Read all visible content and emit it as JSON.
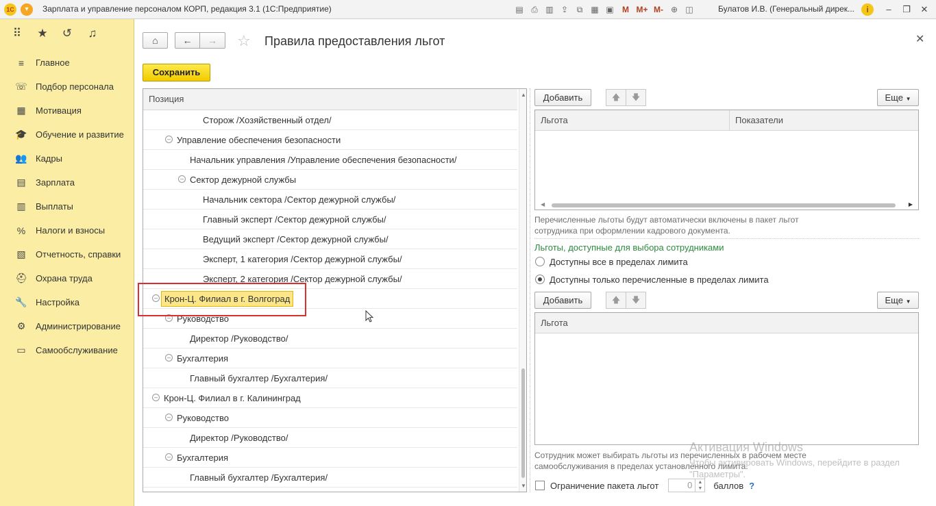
{
  "window": {
    "title": "Зарплата и управление персоналом КОРП, редакция 3.1  (1С:Предприятие)",
    "user": "Булатов И.В. (Генеральный дирек...",
    "toolbar_icons": [
      "save-icon",
      "print-icon",
      "preview-icon",
      "upload-icon",
      "copy-icon",
      "calculator-icon",
      "calendar-icon"
    ],
    "memory_buttons": [
      "M",
      "M+",
      "M-"
    ]
  },
  "sidebar": {
    "items": [
      {
        "label": "Главное",
        "icon": "≡"
      },
      {
        "label": "Подбор персонала",
        "icon": "☏"
      },
      {
        "label": "Мотивация",
        "icon": "▦"
      },
      {
        "label": "Обучение и развитие",
        "icon": "🎓"
      },
      {
        "label": "Кадры",
        "icon": "👥"
      },
      {
        "label": "Зарплата",
        "icon": "▤"
      },
      {
        "label": "Выплаты",
        "icon": "▥"
      },
      {
        "label": "Налоги и взносы",
        "icon": "%"
      },
      {
        "label": "Отчетность, справки",
        "icon": "▧"
      },
      {
        "label": "Охрана труда",
        "icon": "⛑"
      },
      {
        "label": "Настройка",
        "icon": "🔧"
      },
      {
        "label": "Администрирование",
        "icon": "⚙"
      },
      {
        "label": "Самообслуживание",
        "icon": "▭"
      }
    ]
  },
  "page": {
    "title": "Правила предоставления льгот",
    "save_label": "Сохранить"
  },
  "tree": {
    "header": "Позиция",
    "rows": [
      {
        "text": "Сторож /Хозяйственный отдел/",
        "level": 4,
        "toggle": false
      },
      {
        "text": "Управление обеспечения безопасности",
        "level": 2,
        "toggle": true
      },
      {
        "text": "Начальник управления /Управление обеспечения безопасности/",
        "level": 3,
        "toggle": false
      },
      {
        "text": "Сектор дежурной службы",
        "level": 3,
        "toggle": true
      },
      {
        "text": "Начальник сектора /Сектор дежурной службы/",
        "level": 4,
        "toggle": false
      },
      {
        "text": "Главный эксперт /Сектор дежурной службы/",
        "level": 4,
        "toggle": false
      },
      {
        "text": "Ведущий эксперт /Сектор дежурной службы/",
        "level": 4,
        "toggle": false
      },
      {
        "text": "Эксперт, 1 категория /Сектор дежурной службы/",
        "level": 4,
        "toggle": false
      },
      {
        "text": "Эксперт, 2 категория /Сектор дежурной службы/",
        "level": 4,
        "toggle": false
      },
      {
        "text": "Крон-Ц. Филиал в г. Волгоград",
        "level": 1,
        "toggle": true,
        "selected": true
      },
      {
        "text": "Руководство",
        "level": 2,
        "toggle": true
      },
      {
        "text": "Директор /Руководство/",
        "level": 3,
        "toggle": false
      },
      {
        "text": "Бухгалтерия",
        "level": 2,
        "toggle": true
      },
      {
        "text": "Главный бухгалтер /Бухгалтерия/",
        "level": 3,
        "toggle": false
      },
      {
        "text": "Крон-Ц. Филиал в г. Калининград",
        "level": 1,
        "toggle": true
      },
      {
        "text": "Руководство",
        "level": 2,
        "toggle": true
      },
      {
        "text": "Директор /Руководство/",
        "level": 3,
        "toggle": false
      },
      {
        "text": "Бухгалтерия",
        "level": 2,
        "toggle": true
      },
      {
        "text": "Главный бухгалтер /Бухгалтерия/",
        "level": 3,
        "toggle": false
      }
    ]
  },
  "benefits_top": {
    "add_label": "Добавить",
    "more_label": "Еще",
    "col_benefit": "Льгота",
    "col_indicators": "Показатели",
    "note": "Перечисленные льготы будут автоматически включены в пакет льгот сотрудника при оформлении кадрового документа."
  },
  "choice": {
    "title": "Льготы, доступные для выбора сотрудниками",
    "option_all": "Доступны все в пределах лимита",
    "option_listed": "Доступны только перечисленные в пределах лимита",
    "selected": "option_listed"
  },
  "benefits_bottom": {
    "add_label": "Добавить",
    "more_label": "Еще",
    "col_benefit": "Льгота",
    "note": "Сотрудник может выбирать льготы из перечисленных в рабочем месте самообслуживания в пределах установленного лимита."
  },
  "limit": {
    "checkbox_label": "Ограничение пакета льгот",
    "value": "0",
    "unit": "баллов",
    "help": "?"
  },
  "watermark": {
    "title": "Активация Windows",
    "text": "Чтобы активировать Windows, перейдите в раздел \"Параметры\"."
  }
}
